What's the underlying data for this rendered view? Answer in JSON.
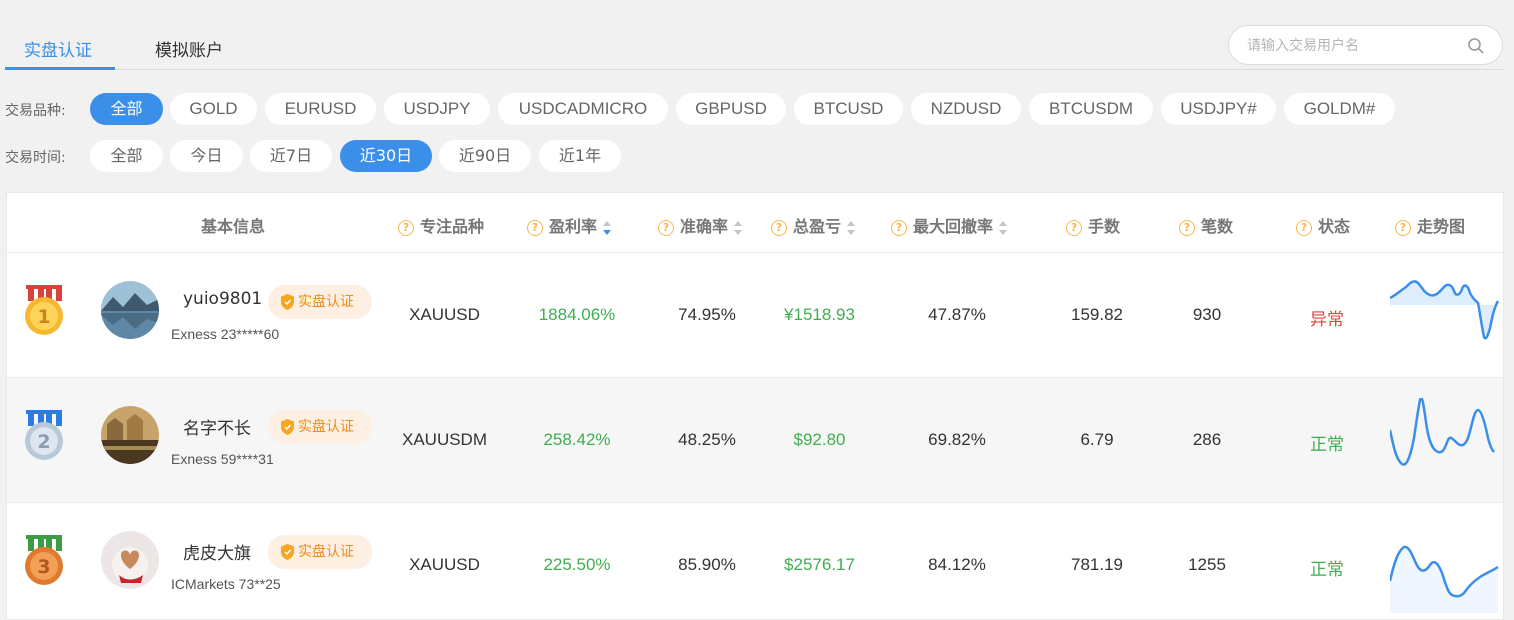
{
  "tabs": [
    {
      "label": "实盘认证",
      "active": true
    },
    {
      "label": "模拟账户",
      "active": false
    }
  ],
  "search": {
    "placeholder": "请输入交易用户名"
  },
  "filters": {
    "symbol_label": "交易品种:",
    "symbols": [
      "全部",
      "GOLD",
      "EURUSD",
      "USDJPY",
      "USDCADMICRO",
      "GBPUSD",
      "BTCUSD",
      "NZDUSD",
      "BTCUSDM",
      "USDJPY#",
      "GOLDM#"
    ],
    "symbol_selected": "全部",
    "time_label": "交易时间:",
    "times": [
      "全部",
      "今日",
      "近7日",
      "近30日",
      "近90日",
      "近1年"
    ],
    "time_selected": "近30日"
  },
  "table": {
    "headers": {
      "basic": "基本信息",
      "symbol": "专注品种",
      "profit_rate": "盈利率",
      "accuracy": "准确率",
      "total_pnl": "总盈亏",
      "max_drawdown": "最大回撤率",
      "lots": "手数",
      "trades": "笔数",
      "status": "状态",
      "trend": "走势图"
    },
    "rows": [
      {
        "rank": "1",
        "name": "yuio9801",
        "badge": "实盘认证",
        "account": "Exness  23*****60",
        "symbol": "XAUUSD",
        "profit_rate": "1884.06%",
        "accuracy": "74.95%",
        "total_pnl": "¥1518.93",
        "max_drawdown": "47.87%",
        "lots": "159.82",
        "trades": "930",
        "status": "异常",
        "status_type": "abnormal"
      },
      {
        "rank": "2",
        "name": "名字不长",
        "badge": "实盘认证",
        "account": "Exness  59****31",
        "symbol": "XAUUSDM",
        "profit_rate": "258.42%",
        "accuracy": "48.25%",
        "total_pnl": "$92.80",
        "max_drawdown": "69.82%",
        "lots": "6.79",
        "trades": "286",
        "status": "正常",
        "status_type": "normal"
      },
      {
        "rank": "3",
        "name": "虎皮大旗",
        "badge": "实盘认证",
        "account": "ICMarkets  73**25",
        "symbol": "XAUUSD",
        "profit_rate": "225.50%",
        "accuracy": "85.90%",
        "total_pnl": "$2576.17",
        "max_drawdown": "84.12%",
        "lots": "781.19",
        "trades": "1255",
        "status": "正常",
        "status_type": "normal"
      }
    ]
  },
  "colors": {
    "accent": "#3b8fe8",
    "positive": "#3fae4e",
    "negative": "#e0463b",
    "badge": "#f08c1a",
    "gold": "#f5b94e",
    "silver": "#c9d6e2",
    "bronze": "#e8843a"
  }
}
